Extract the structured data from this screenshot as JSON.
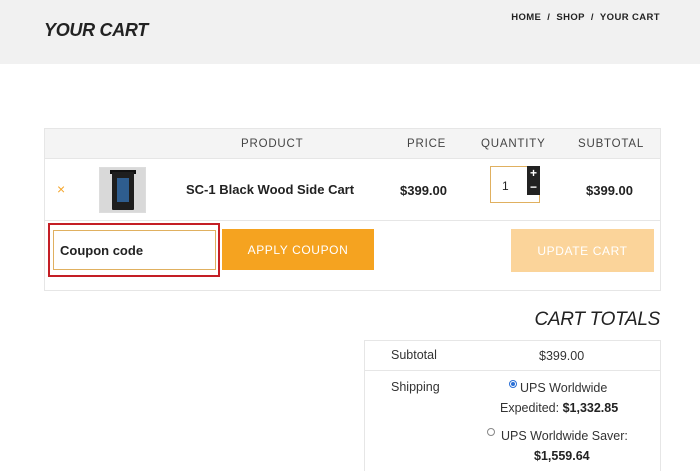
{
  "header": {
    "title": "YOUR CART",
    "breadcrumb": {
      "home": "HOME",
      "sep1": "/",
      "shop": "SHOP",
      "sep2": "/",
      "current": "YOUR CART"
    }
  },
  "cart_table": {
    "columns": {
      "product": "PRODUCT",
      "price": "PRICE",
      "quantity": "QUANTITY",
      "subtotal": "SUBTOTAL"
    },
    "items": [
      {
        "remove_icon": "×",
        "name": "SC-1 Black Wood Side Cart",
        "price": "$399.00",
        "quantity": "1",
        "subtotal": "$399.00"
      }
    ],
    "qty_plus": "+",
    "qty_minus": "−"
  },
  "actions": {
    "coupon_placeholder": "Coupon code",
    "apply_coupon": "APPLY COUPON",
    "update_cart": "UPDATE CART"
  },
  "totals": {
    "title": "CART TOTALS",
    "subtotal_label": "Subtotal",
    "subtotal_value": "$399.00",
    "shipping_label": "Shipping",
    "shipping_options": [
      {
        "line1": "UPS Worldwide",
        "line2_label": "Expedited:",
        "price": "$1,332.85",
        "selected": true
      },
      {
        "line1": "UPS Worldwide Saver:",
        "price": "$1,559.64",
        "selected": false
      }
    ]
  },
  "colors": {
    "accent": "#f5a320",
    "accent_disabled": "#fbd49a",
    "highlight": "#c41e25",
    "radio": "#2a6fd6"
  }
}
